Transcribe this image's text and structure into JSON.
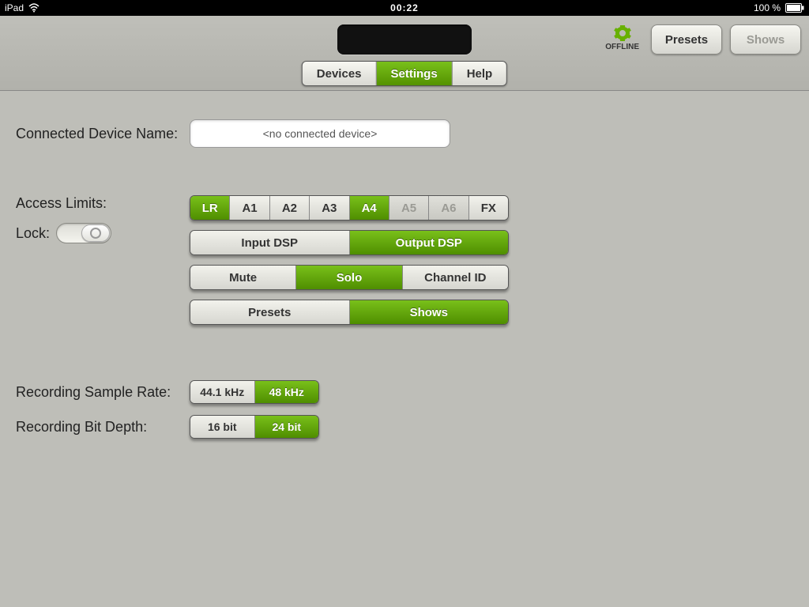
{
  "status_bar": {
    "carrier": "iPad",
    "time": "00:22",
    "battery_text": "100 %"
  },
  "top": {
    "offline_label": "OFFLINE",
    "presets_label": "Presets",
    "shows_label": "Shows"
  },
  "tabs": {
    "devices": "Devices",
    "settings": "Settings",
    "help": "Help",
    "active": "settings"
  },
  "device": {
    "label": "Connected Device Name:",
    "value": "<no connected device>"
  },
  "access": {
    "label": "Access Limits:",
    "lock_label": "Lock:",
    "channels": [
      {
        "label": "LR",
        "state": "active"
      },
      {
        "label": "A1",
        "state": "normal"
      },
      {
        "label": "A2",
        "state": "normal"
      },
      {
        "label": "A3",
        "state": "normal"
      },
      {
        "label": "A4",
        "state": "active"
      },
      {
        "label": "A5",
        "state": "dim"
      },
      {
        "label": "A6",
        "state": "dim"
      },
      {
        "label": "FX",
        "state": "normal"
      }
    ],
    "dsp": {
      "input": "Input DSP",
      "output": "Output DSP",
      "active": "output"
    },
    "msc": {
      "mute": "Mute",
      "solo": "Solo",
      "channel_id": "Channel ID",
      "active": "solo"
    },
    "ps": {
      "presets": "Presets",
      "shows": "Shows",
      "active": "shows"
    }
  },
  "recording": {
    "sample_rate_label": "Recording Sample Rate:",
    "sample_rate": {
      "a": "44.1 kHz",
      "b": "48 kHz",
      "active": "b"
    },
    "bit_depth_label": "Recording Bit Depth:",
    "bit_depth": {
      "a": "16 bit",
      "b": "24 bit",
      "active": "b"
    }
  }
}
